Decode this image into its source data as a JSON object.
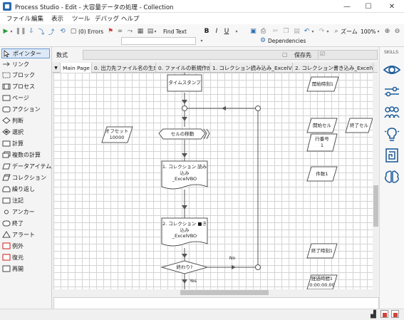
{
  "window": {
    "title": "Process Studio  - Edit - 大容量データの処理 - Collection",
    "minimize": "—",
    "maximize": "☐",
    "close": "✕"
  },
  "menu": [
    "ファイル",
    "編集",
    "表示",
    "ツール",
    "デバッグ",
    "ヘルプ"
  ],
  "toolbar": {
    "errors": "(0) Errors",
    "find_text": "Find Text",
    "dependencies": "Dependencies",
    "bold": "B",
    "italic": "I",
    "underline": "U",
    "zoom_label": "ズーム",
    "zoom_value": "100%"
  },
  "toolbox": {
    "items": [
      "ポインター",
      "リンク",
      "ブロック",
      "プロセス",
      "ページ",
      "アクション",
      "判断",
      "選択",
      "計算",
      "複数の計算",
      "データアイテム",
      "コレクション",
      "繰り返し",
      "注記",
      "アンカー",
      "終了",
      "アラート",
      "例外",
      "復元",
      "再開"
    ]
  },
  "formula": {
    "label": "数式",
    "save_to": "保存先"
  },
  "tabs": [
    "Main Page",
    "0. 出力先ファイル名の生成",
    "0. ファイルの新規作成",
    "1. コレクション読み込み_ExcelVBO",
    "2. コレクション書き込み_ExcelVBO"
  ],
  "skills_title": "SKILLS",
  "stages": {
    "timestamp": "タイムスタンプ",
    "move_cell": "セルの移動",
    "read_collection": "1. コレクション 読み込み\n_ExcelVBO",
    "write_collection": "2. コレクション ■き込み\n_ExcelVBO",
    "finished": "終わり?",
    "no_label": "No",
    "yes_label": "Yes",
    "offset": "オフセット\n10000",
    "start_time": "開始時刻1",
    "start_cell": "開始セル",
    "end_cell": "終了セル",
    "row_count": "行番号\n1",
    "item_count": "件数1",
    "end_time": "終了時刻1",
    "elapsed": "経過時間1\n0:00:00.00"
  },
  "colors": {
    "accent": "#2b6cb0",
    "selected_tool": "#dde9f7",
    "skill_icon": "#1e5d9b",
    "flow_line": "#555555"
  }
}
